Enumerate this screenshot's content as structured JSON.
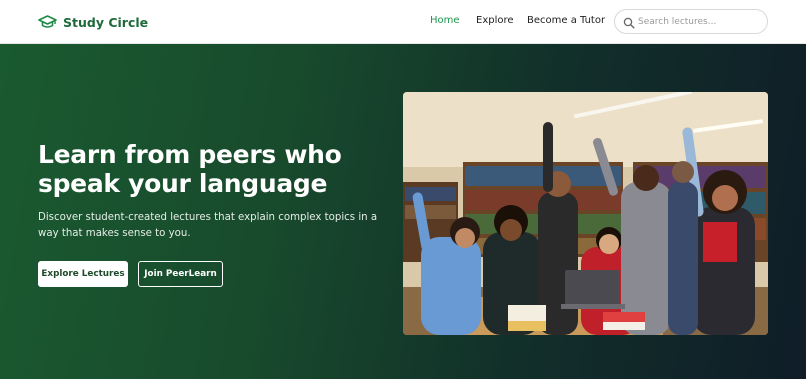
{
  "brand": {
    "name": "Study Circle",
    "icon": "graduation-cap-icon",
    "color": "#1e6a3b"
  },
  "nav": {
    "links": [
      {
        "label": "Home",
        "active": true
      },
      {
        "label": "Explore",
        "active": false
      },
      {
        "label": "Become a Tutor",
        "active": false
      }
    ],
    "active_color": "#1e9a4d"
  },
  "search": {
    "placeholder": "Search lectures...",
    "value": "",
    "icon": "search-icon"
  },
  "hero": {
    "title": "Learn from peers who speak your language",
    "subtitle": "Discover student-created lectures that explain complex topics in a way that makes sense to you.",
    "primary_button": "Explore Lectures",
    "secondary_button": "Join PeerLearn",
    "image_alt": "Group of cheering students in a library"
  }
}
